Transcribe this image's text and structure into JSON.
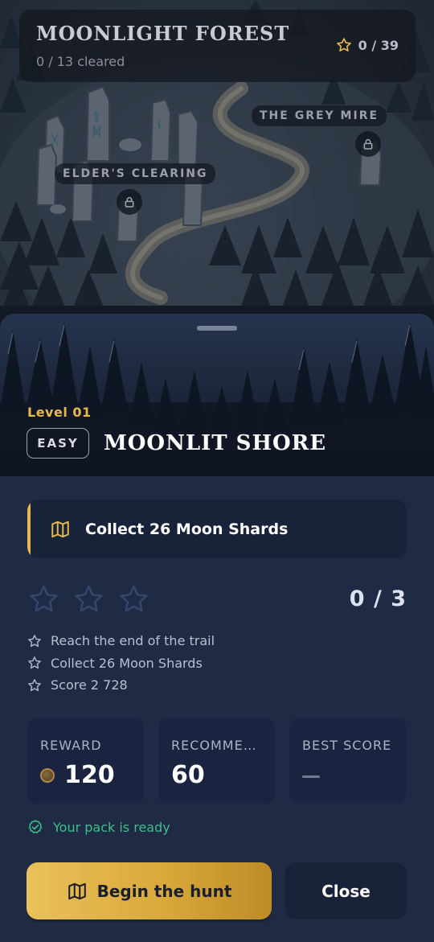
{
  "world": {
    "title": "MOONLIGHT FOREST",
    "progress": "0 / 13 cleared",
    "stars": "0 / 39",
    "locations": [
      {
        "name": "THE GREY MIRE",
        "locked": true
      },
      {
        "name": "ELDER'S CLEARING",
        "locked": true
      }
    ]
  },
  "level": {
    "number": "Level 01",
    "difficulty": "EASY",
    "name": "MOONLIT SHORE",
    "objective": "Collect 26 Moon Shards",
    "stars_earned": 0,
    "stars_total": 3,
    "star_count": "0 / 3",
    "requirements": [
      "Reach the end of the trail",
      "Collect 26 Moon Shards",
      "Score 2 728"
    ]
  },
  "stats": {
    "reward": {
      "label": "REWARD",
      "value": "120"
    },
    "recommended": {
      "label": "RECOMMENDED",
      "value": "60"
    },
    "best_score": {
      "label": "BEST SCORE",
      "value": null
    }
  },
  "status": "Your pack is ready",
  "buttons": {
    "start": "Begin the hunt",
    "close": "Close"
  },
  "colors": {
    "accent_gold": "#e6b94c",
    "sheet_bg": "#1f2b45",
    "ready_green": "#3fbf8a"
  }
}
